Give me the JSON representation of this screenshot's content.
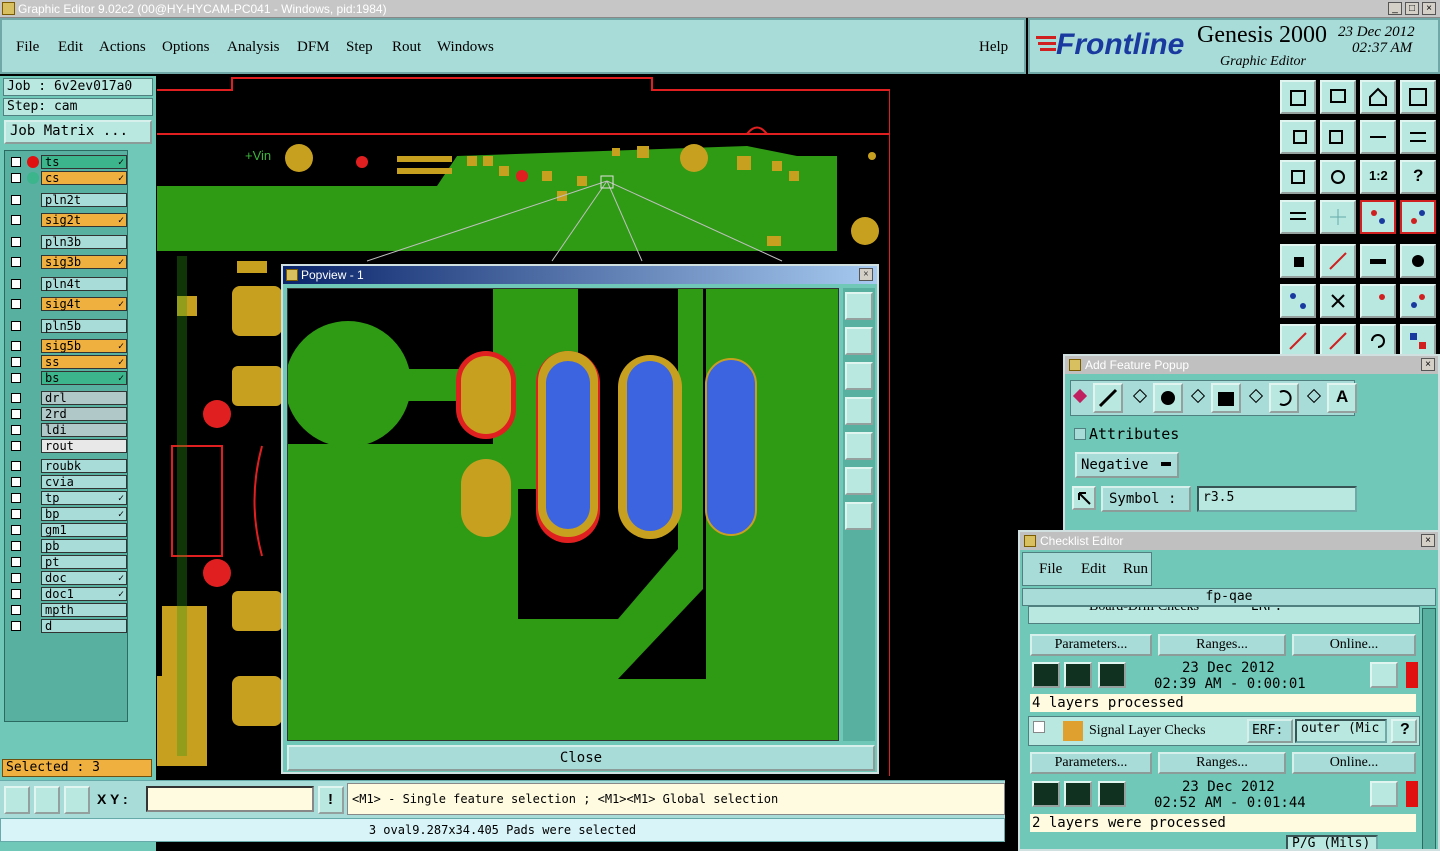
{
  "window": {
    "title": "Graphic Editor 9.02c2 (00@HY-HYCAM-PC041 - Windows, pid:1984)"
  },
  "menu": [
    "File",
    "Edit",
    "Actions",
    "Options",
    "Analysis",
    "DFM",
    "Step",
    "Rout",
    "Windows"
  ],
  "help_label": "Help",
  "brand": {
    "logo": "Frontline",
    "product": "Genesis 2000",
    "subtitle": "Graphic Editor",
    "date": "23 Dec 2012",
    "time": "02:37 AM"
  },
  "job": {
    "job_line": "Job : 6v2ev017a0",
    "step_line": "Step: cam",
    "matrix_button": "Job Matrix ..."
  },
  "layers": [
    {
      "name": "ts",
      "color": "#3cb48c",
      "flag": "✓"
    },
    {
      "name": "cs",
      "color": "#f0b040",
      "flag": "✓"
    },
    {
      "name": "pln2t",
      "color": "#a8dcd8",
      "flag": ""
    },
    {
      "name": "sig2t",
      "color": "#f0b040",
      "flag": "✓"
    },
    {
      "name": "pln3b",
      "color": "#a8dcd8",
      "flag": ""
    },
    {
      "name": "sig3b",
      "color": "#f0b040",
      "flag": "✓"
    },
    {
      "name": "pln4t",
      "color": "#a8dcd8",
      "flag": ""
    },
    {
      "name": "sig4t",
      "color": "#f0b040",
      "flag": "✓"
    },
    {
      "name": "pln5b",
      "color": "#a8dcd8",
      "flag": ""
    },
    {
      "name": "sig5b",
      "color": "#f0b040",
      "flag": "✓"
    },
    {
      "name": "ss",
      "color": "#f0b040",
      "flag": "✓"
    },
    {
      "name": "bs",
      "color": "#3cb48c",
      "flag": "✓"
    },
    {
      "name": "drl",
      "color": "#b0c8c8",
      "flag": ""
    },
    {
      "name": "2rd",
      "color": "#b0c8c8",
      "flag": ""
    },
    {
      "name": "ldi",
      "color": "#b0c8c8",
      "flag": ""
    },
    {
      "name": "rout",
      "color": "#e8e8e8",
      "flag": ""
    },
    {
      "name": "roubk",
      "color": "#a8dcd8",
      "flag": ""
    },
    {
      "name": "cvia",
      "color": "#a8dcd8",
      "flag": ""
    },
    {
      "name": "tp",
      "color": "#a8dcd8",
      "flag": "✓"
    },
    {
      "name": "bp",
      "color": "#a8dcd8",
      "flag": "✓"
    },
    {
      "name": "gm1",
      "color": "#a8dcd8",
      "flag": ""
    },
    {
      "name": "pb",
      "color": "#a8dcd8",
      "flag": ""
    },
    {
      "name": "pt",
      "color": "#a8dcd8",
      "flag": ""
    },
    {
      "name": "doc",
      "color": "#a8dcd8",
      "flag": "✓"
    },
    {
      "name": "doc1",
      "color": "#a8dcd8",
      "flag": "✓"
    },
    {
      "name": "mpth",
      "color": "#a8dcd8",
      "flag": ""
    },
    {
      "name": "d",
      "color": "#a8dcd8",
      "flag": ""
    }
  ],
  "selected_text": "Selected : 3",
  "canvas": {
    "label": "+Vin"
  },
  "popview": {
    "title": "Popview - 1",
    "close_label": "Close"
  },
  "add_feature": {
    "title": "Add Feature Popup",
    "attributes_label": "Attributes",
    "polarity": "Negative",
    "symbol_label": "Symbol :",
    "symbol_value": "r3.5"
  },
  "checklist": {
    "title": "Checklist Editor",
    "menu": [
      "File",
      "Edit",
      "Run"
    ],
    "name": "fp-qae",
    "rows": [
      {
        "title": "Board-Drill Checks",
        "erf": "ERF:",
        "erf_value": "",
        "date": "23 Dec 2012",
        "time": "02:39 AM - 0:00:01",
        "status": "4 layers processed"
      },
      {
        "title": "Signal Layer Checks",
        "erf": "ERF:",
        "erf_value": "outer (Mic",
        "date": "23 Dec 2012",
        "time": "02:52 AM - 0:01:44",
        "status": "2 layers were processed"
      }
    ],
    "parameters": "Parameters...",
    "ranges": "Ranges...",
    "online": "Online...",
    "next_erf_value": "P/G (Mils)"
  },
  "bottom": {
    "xy_label": "X Y :",
    "xy_value": "",
    "prompt": "<M1> - Single feature selection ; <M1><M1> Global selection",
    "status": "3 oval9.287x34.405 Pads were selected"
  }
}
